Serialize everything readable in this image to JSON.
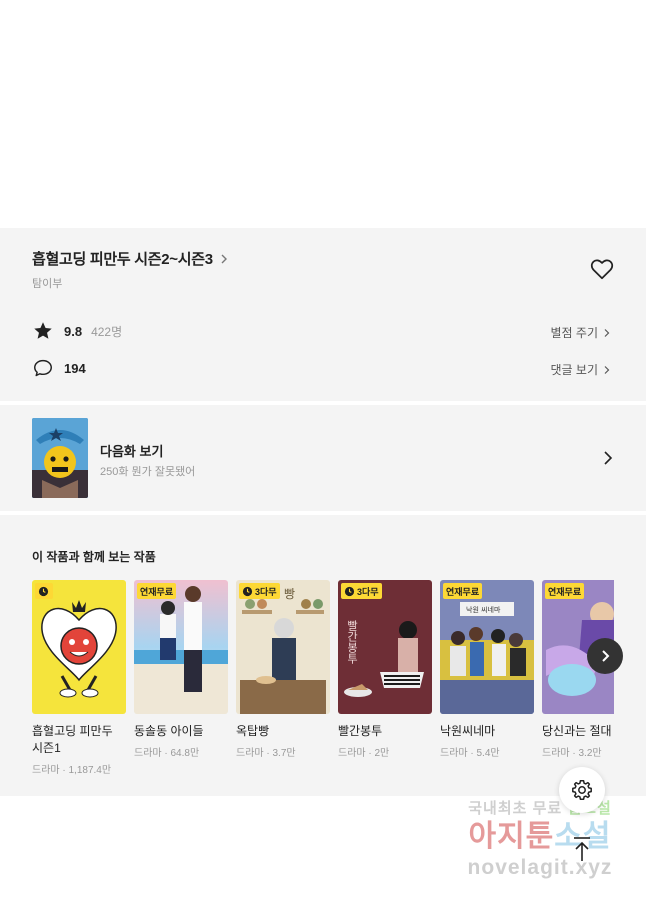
{
  "work": {
    "title": "흡혈고딩 피만두 시즌2~시즌3",
    "author": "탐이부",
    "rating": "9.8",
    "rating_count": "422명",
    "rate_link": "별점 주기",
    "comments": "194",
    "comments_link": "댓글 보기"
  },
  "next_episode": {
    "label": "다음화 보기",
    "subtitle": "250화 뭔가 잘못됐어"
  },
  "recommendations": {
    "heading": "이 작품과 함께 보는 작품",
    "items": [
      {
        "title": "흡혈고딩 피만두 시즌1",
        "meta": "드라마 · 1,187.4만",
        "badge": "",
        "cover": "#f4e23a"
      },
      {
        "title": "동솔동 아이들",
        "meta": "드라마 · 64.8만",
        "badge": "연재무료",
        "cover": "#9fc6e8"
      },
      {
        "title": "옥탑빵",
        "meta": "드라마 · 3.7만",
        "badge": "3다무",
        "cover": "#e8e0cc"
      },
      {
        "title": "빨간봉투",
        "meta": "드라마 · 2만",
        "badge": "3다무",
        "cover": "#6b2d34"
      },
      {
        "title": "낙원씨네마",
        "meta": "드라마 · 5.4만",
        "badge": "연재무료",
        "cover": "#7a86b8"
      },
      {
        "title": "당신과는 절대",
        "meta": "드라마 · 3.2만",
        "badge": "연재무료",
        "cover": "#8f7ab8"
      }
    ]
  },
  "cover_text": {
    "red_envelope": "빨간봉투",
    "cinema": "낙원 씨네마",
    "bread": "빵"
  },
  "watermark": {
    "line1_a": "국내최초 무료 ",
    "line1_b": "웹소설",
    "line2_a": "아지툰",
    "line2_b": "소설",
    "line3": "novelagit.xyz"
  },
  "colors": {
    "badge": "#fdd835",
    "section_bg": "#f4f4f4"
  }
}
